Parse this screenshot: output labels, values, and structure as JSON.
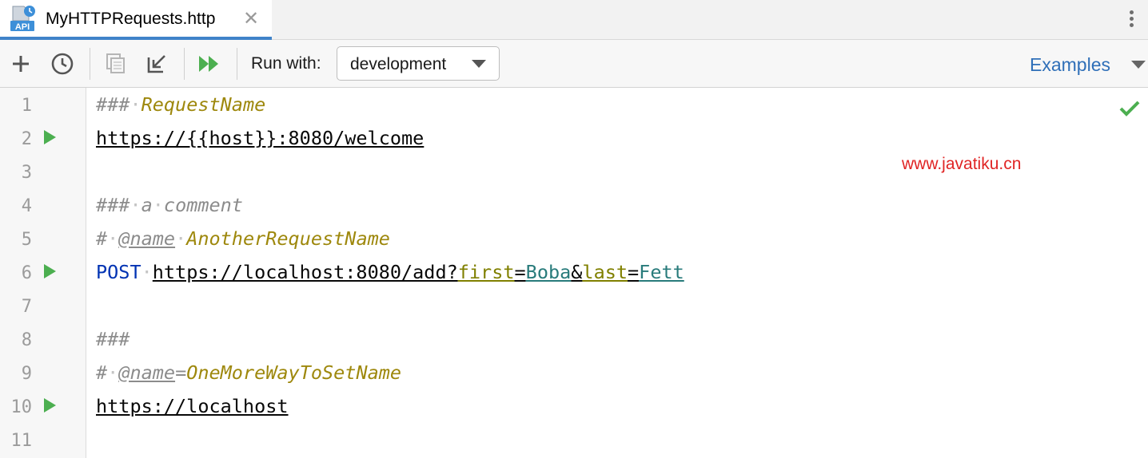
{
  "tab": {
    "title": "MyHTTPRequests.http",
    "icon_text": "API",
    "close_glyph": "✕"
  },
  "toolbar": {
    "run_with_label": "Run with:",
    "environment": "development",
    "examples_label": "Examples"
  },
  "editor": {
    "line_numbers": [
      "1",
      "2",
      "3",
      "4",
      "5",
      "6",
      "7",
      "8",
      "9",
      "10",
      "11"
    ],
    "lines": {
      "l1": {
        "hash": "###",
        "dot": "·",
        "name": "RequestName"
      },
      "l2": {
        "url": "https://{{host}}:8080/welcome"
      },
      "l4": {
        "hash": "###",
        "dot1": "·",
        "a": "a",
        "dot2": "·",
        "comment": "comment"
      },
      "l5": {
        "hash": "#",
        "dot1": "·",
        "tag": "@name",
        "dot2": "·",
        "name": "AnotherRequestName"
      },
      "l6": {
        "method": "POST",
        "dot": "·",
        "url": "https://localhost:8080/add?",
        "key1": "first",
        "eq1": "=",
        "val1": "Boba",
        "amp": "&",
        "key2": "last",
        "eq2": "=",
        "val2": "Fett"
      },
      "l8": {
        "hash": "###"
      },
      "l9": {
        "hash": "#",
        "dot": "·",
        "tag": "@name",
        "eq": "=",
        "name": "OneMoreWayToSetName"
      },
      "l10": {
        "url": "https://localhost"
      }
    }
  },
  "watermark": "www.javatiku.cn",
  "colors": {
    "accent": "#4083c9",
    "run_green": "#4caf50",
    "keyword_blue": "#0033b3",
    "link_blue": "#2f6fb8"
  },
  "icons": [
    "api-file-icon",
    "add-icon",
    "history-icon",
    "copy-icon",
    "import-icon",
    "run-all-icon",
    "run-request-icon",
    "check-icon",
    "more-icon"
  ]
}
